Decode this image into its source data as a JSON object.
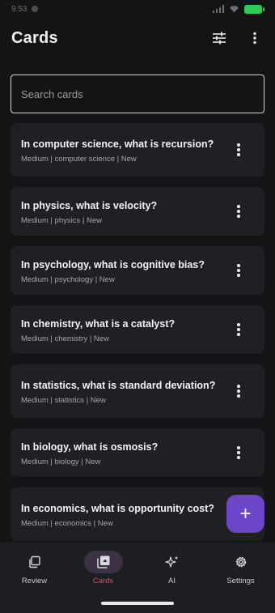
{
  "status_bar": {
    "time": "9:53"
  },
  "header": {
    "title": "Cards"
  },
  "search": {
    "placeholder": "Search cards",
    "value": ""
  },
  "cards": [
    {
      "question": "In computer science, what is recursion?",
      "meta": "Medium | computer science | New"
    },
    {
      "question": "In physics, what is velocity?",
      "meta": "Medium | physics | New"
    },
    {
      "question": "In psychology, what is cognitive bias?",
      "meta": "Medium | psychology | New"
    },
    {
      "question": "In chemistry, what is a catalyst?",
      "meta": "Medium | chemistry | New"
    },
    {
      "question": "In statistics, what is standard deviation?",
      "meta": "Medium | statistics | New"
    },
    {
      "question": "In biology, what is osmosis?",
      "meta": "Medium | biology | New"
    },
    {
      "question": "In economics, what is opportunity cost?",
      "meta": "Medium | economics | New"
    }
  ],
  "fab": {
    "label": "+"
  },
  "bottom_nav": [
    {
      "label": "Review",
      "icon": "review-icon",
      "active": false
    },
    {
      "label": "Cards",
      "icon": "cards-icon",
      "active": true
    },
    {
      "label": "AI",
      "icon": "ai-sparkle-icon",
      "active": false
    },
    {
      "label": "Settings",
      "icon": "gear-icon",
      "active": false
    }
  ],
  "colors": {
    "background": "#121416",
    "card": "#1e2023",
    "accent": "#6b46c8",
    "active_label": "#e05050",
    "battery": "#2ecc55"
  }
}
